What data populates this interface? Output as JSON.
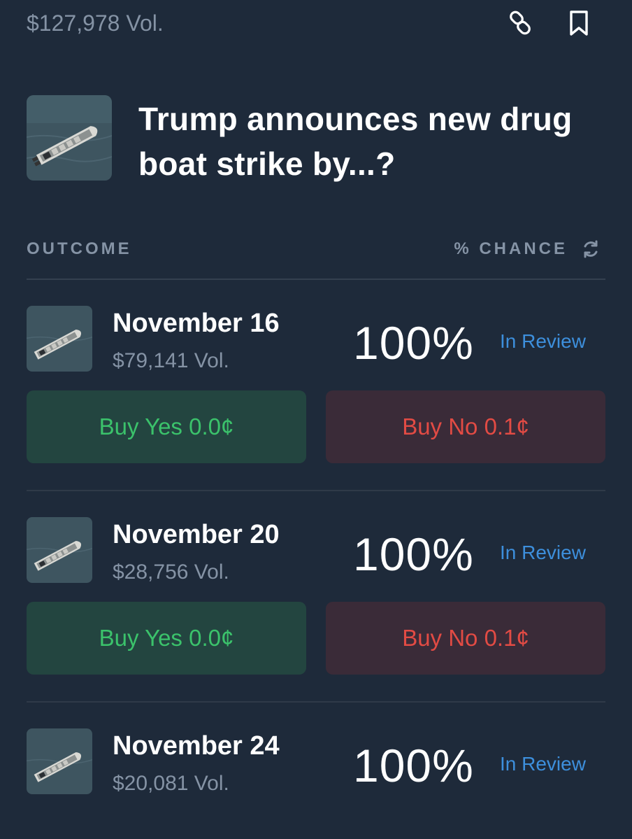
{
  "market": {
    "volume": "$127,978 Vol.",
    "title": "Trump announces new drug boat strike by...?"
  },
  "icons": {
    "link": "link-icon",
    "bookmark": "bookmark-icon",
    "refresh": "refresh-icon"
  },
  "table_header": {
    "outcome": "OUTCOME",
    "chance": "% CHANCE"
  },
  "outcomes": [
    {
      "name": "November 16",
      "volume": "$79,141 Vol.",
      "chance": "100%",
      "status": "In Review",
      "buy_yes": "Buy Yes 0.0¢",
      "buy_no": "Buy No 0.1¢"
    },
    {
      "name": "November 20",
      "volume": "$28,756 Vol.",
      "chance": "100%",
      "status": "In Review",
      "buy_yes": "Buy Yes 0.0¢",
      "buy_no": "Buy No 0.1¢"
    },
    {
      "name": "November 24",
      "volume": "$20,081 Vol.",
      "chance": "100%",
      "status": "In Review"
    }
  ],
  "colors": {
    "background": "#1e2a3a",
    "yes_text": "#3bc26b",
    "no_text": "#e24b44",
    "status_text": "#3d8fdc"
  }
}
